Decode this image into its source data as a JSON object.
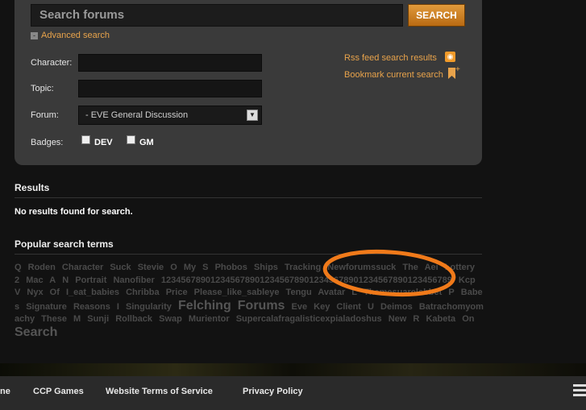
{
  "search": {
    "placeholder": "Search forums",
    "button_label": "SEARCH",
    "advanced_label": "Advanced search",
    "advanced_toggle": "-"
  },
  "form": {
    "character_label": "Character:",
    "topic_label": "Topic:",
    "forum_label": "Forum:",
    "forum_value": "- EVE General Discussion",
    "badges_label": "Badges:",
    "dev_label": "DEV",
    "gm_label": "GM"
  },
  "links": {
    "rss": "Rss feed search results",
    "bookmark": "Bookmark current search"
  },
  "results": {
    "title": "Results",
    "message": "No results found for search."
  },
  "popular": {
    "title": "Popular search terms",
    "terms": [
      "Q",
      "Roden",
      "Character",
      "Suck",
      "Stevie",
      "O",
      "My",
      "S",
      "Phobos",
      "Ships",
      "Tracking",
      "Newforumssuck",
      "The",
      "Aei",
      "Lottery",
      "2",
      "Mac",
      "A",
      "N",
      "Portrait",
      "Nanofiber",
      "12345678901234567890123456789012345678901234567890123456789",
      "Kcp",
      "V",
      "Nyx",
      "Of",
      "I_eat_babies",
      "Chribba",
      "Price",
      "Please_like_sableye",
      "Tengu",
      "Avatar",
      "L",
      "Themesuarelebbet",
      "P",
      "Babes",
      "Signature",
      "Reasons",
      "I",
      "Singularity",
      "Felching",
      "Forums",
      "Eve",
      "Key",
      "Client",
      "U",
      "Deimos",
      "Batrachomyomachy",
      "These",
      "M",
      "Sunji",
      "Rollback",
      "Swap",
      "Murientor",
      "Supercalafragalisticexpialadoshus",
      "New",
      "R",
      "Kabeta",
      "On",
      "Search"
    ],
    "large_terms": [
      "Felching",
      "Forums",
      "Search"
    ]
  },
  "footer": {
    "links": [
      "ne",
      "CCP Games",
      "Website Terms of Service",
      "Privacy Policy"
    ]
  },
  "colors": {
    "accent": "#e8a34b",
    "annotation": "#f07a1a",
    "panel": "#3a3a3a"
  }
}
